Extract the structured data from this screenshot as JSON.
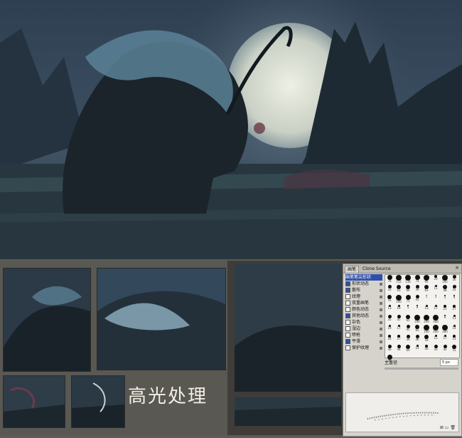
{
  "caption": "高光处理",
  "panel": {
    "tabs": [
      "画笔",
      "Clone Source"
    ],
    "close": "×",
    "options": [
      {
        "label": "画笔笔尖形状",
        "checked": false,
        "selected": true,
        "check": false
      },
      {
        "label": "形状动态",
        "checked": true,
        "selected": false,
        "check": true
      },
      {
        "label": "散布",
        "checked": true,
        "selected": false,
        "check": true
      },
      {
        "label": "纹理",
        "checked": false,
        "selected": false,
        "check": true
      },
      {
        "label": "双重画笔",
        "checked": false,
        "selected": false,
        "check": true
      },
      {
        "label": "颜色动态",
        "checked": false,
        "selected": false,
        "check": true
      },
      {
        "label": "其他动态",
        "checked": true,
        "selected": false,
        "check": true
      },
      {
        "label": "杂色",
        "checked": false,
        "selected": false,
        "check": true
      },
      {
        "label": "湿边",
        "checked": false,
        "selected": false,
        "check": true
      },
      {
        "label": "喷枪",
        "checked": false,
        "selected": false,
        "check": true
      },
      {
        "label": "平滑",
        "checked": true,
        "selected": false,
        "check": true
      },
      {
        "label": "保护纹理",
        "checked": false,
        "selected": false,
        "check": true
      }
    ],
    "brush_sizes": [
      "78",
      "112",
      "134",
      "74",
      "95",
      "29",
      "192",
      "36",
      "33",
      "63",
      "66",
      "39",
      "63",
      "11",
      "48",
      "32",
      "55",
      "100",
      "75",
      "45",
      "1",
      "3",
      "5",
      "9",
      "13",
      "19",
      "5",
      "9",
      "13",
      "17",
      "21",
      "27",
      "35",
      "45",
      "65",
      "100",
      "200",
      "300",
      "9",
      "13",
      "19",
      "17",
      "45",
      "65",
      "100",
      "200",
      "300",
      "14",
      "24",
      "27",
      "39",
      "46",
      "59",
      "11",
      "17",
      "23",
      "36",
      "44",
      "60",
      "14",
      "26",
      "33",
      "42",
      "55",
      "70"
    ],
    "diameter_label": "主直径",
    "diameter_value": "5 px",
    "footer_icons": "⊞ ▭ 🗑"
  }
}
